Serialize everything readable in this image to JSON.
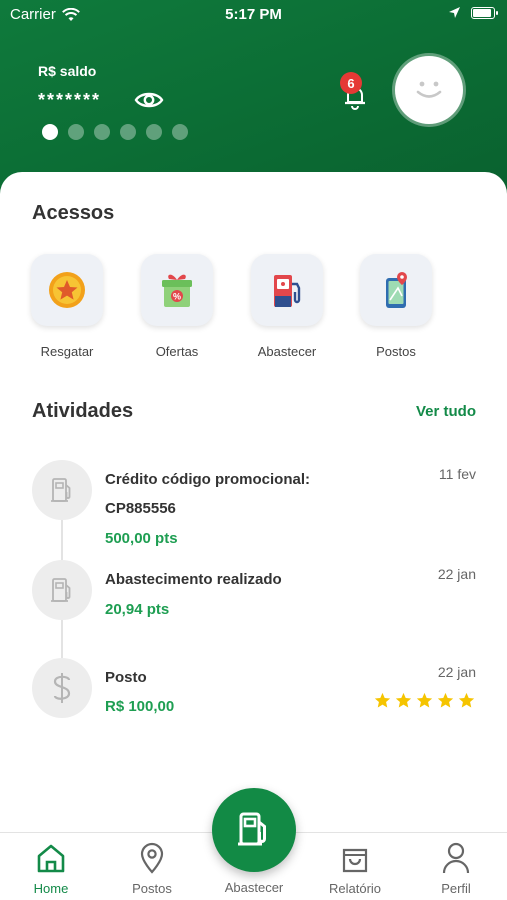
{
  "status_bar": {
    "carrier": "Carrier",
    "time": "5:17 PM"
  },
  "header": {
    "balance_label": "R$ saldo",
    "balance_value": "*******",
    "notification_count": "6",
    "carousel_dots": 6,
    "carousel_active_index": 0
  },
  "access": {
    "title": "Acessos",
    "items": [
      {
        "label": "Resgatar",
        "icon": "coin-star-icon"
      },
      {
        "label": "Ofertas",
        "icon": "gift-discount-icon"
      },
      {
        "label": "Abastecer",
        "icon": "fuel-pump-icon"
      },
      {
        "label": "Postos",
        "icon": "map-pin-phone-icon"
      }
    ]
  },
  "activities": {
    "title": "Atividades",
    "see_all": "Ver tudo",
    "items": [
      {
        "title_line1": "Crédito código promocional:",
        "title_line2": "CP885556",
        "value": "500,00 pts",
        "date": "11 fev",
        "icon": "fuel-pump-icon"
      },
      {
        "title_line1": "Abastecimento realizado",
        "value": "20,94 pts",
        "date": "22 jan",
        "icon": "fuel-pump-icon"
      },
      {
        "title_line1": "Posto",
        "value": "R$ 100,00",
        "date": "22 jan",
        "icon": "dollar-icon",
        "rating": 5
      }
    ]
  },
  "tabbar": {
    "items": [
      {
        "label": "Home",
        "icon": "home-icon",
        "active": true
      },
      {
        "label": "Postos",
        "icon": "location-pin-icon"
      },
      {
        "label": "Abastecer",
        "icon": "fuel-pump-icon"
      },
      {
        "label": "Relatório",
        "icon": "shopping-bag-icon"
      },
      {
        "label": "Perfil",
        "icon": "person-icon"
      }
    ]
  },
  "colors": {
    "brand_green": "#0f7a3c",
    "accent_green": "#138a48",
    "badge_red": "#e53935",
    "star_yellow": "#f5c400"
  }
}
